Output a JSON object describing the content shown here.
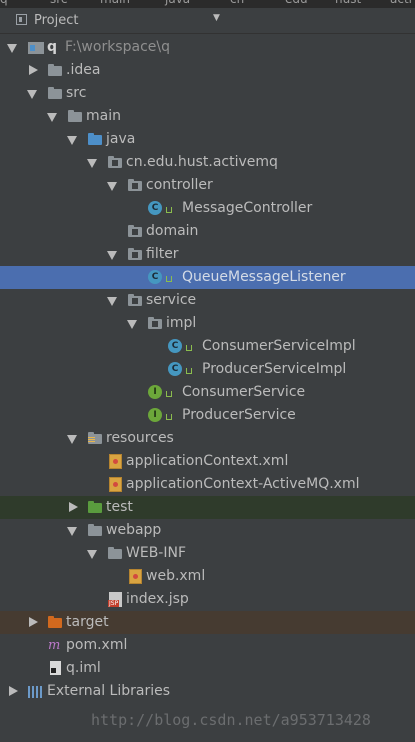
{
  "panel": {
    "title": "Project",
    "dropdown_icon": "triangle-down"
  },
  "top_tabs": [
    "src",
    "main",
    "java",
    "cn",
    "edu",
    "hust",
    "acti"
  ],
  "tree": [
    {
      "label": "q",
      "path": "F:\\workspace\\q",
      "icon": "module",
      "expanded": true
    },
    {
      "label": ".idea",
      "icon": "folder",
      "expanded": false
    },
    {
      "label": "src",
      "icon": "folder",
      "expanded": true
    },
    {
      "label": "main",
      "icon": "folder",
      "expanded": true
    },
    {
      "label": "java",
      "icon": "folder-blue",
      "expanded": true
    },
    {
      "label": "cn.edu.hust.activemq",
      "icon": "package",
      "expanded": true
    },
    {
      "label": "controller",
      "icon": "package",
      "expanded": true
    },
    {
      "label": "MessageController",
      "icon": "class"
    },
    {
      "label": "domain",
      "icon": "package"
    },
    {
      "label": "filter",
      "icon": "package",
      "expanded": true
    },
    {
      "label": "QueueMessageListener",
      "icon": "class",
      "selected": true
    },
    {
      "label": "service",
      "icon": "package",
      "expanded": true
    },
    {
      "label": "impl",
      "icon": "package",
      "expanded": true
    },
    {
      "label": "ConsumerServiceImpl",
      "icon": "class"
    },
    {
      "label": "ProducerServiceImpl",
      "icon": "class"
    },
    {
      "label": "ConsumerService",
      "icon": "interface"
    },
    {
      "label": "ProducerService",
      "icon": "interface"
    },
    {
      "label": "resources",
      "icon": "resources-folder",
      "expanded": true
    },
    {
      "label": "applicationContext.xml",
      "icon": "xml-file"
    },
    {
      "label": "applicationContext-ActiveMQ.xml",
      "icon": "xml-file"
    },
    {
      "label": "test",
      "icon": "folder-green",
      "expanded": false
    },
    {
      "label": "webapp",
      "icon": "folder",
      "expanded": true
    },
    {
      "label": "WEB-INF",
      "icon": "folder",
      "expanded": true
    },
    {
      "label": "web.xml",
      "icon": "xml-file"
    },
    {
      "label": "index.jsp",
      "icon": "jsp-file"
    },
    {
      "label": "target",
      "icon": "folder-orange",
      "expanded": false
    },
    {
      "label": "pom.xml",
      "icon": "maven-file"
    },
    {
      "label": "q.iml",
      "icon": "iml-file"
    },
    {
      "label": "External Libraries",
      "icon": "libraries",
      "expanded": false
    }
  ],
  "watermark": "http://blog.csdn.net/a953713428",
  "colors": {
    "background": "#3c3f41",
    "selection": "#4b6eaf",
    "class_icon": "#4597c0",
    "interface_icon": "#6ca73a"
  }
}
